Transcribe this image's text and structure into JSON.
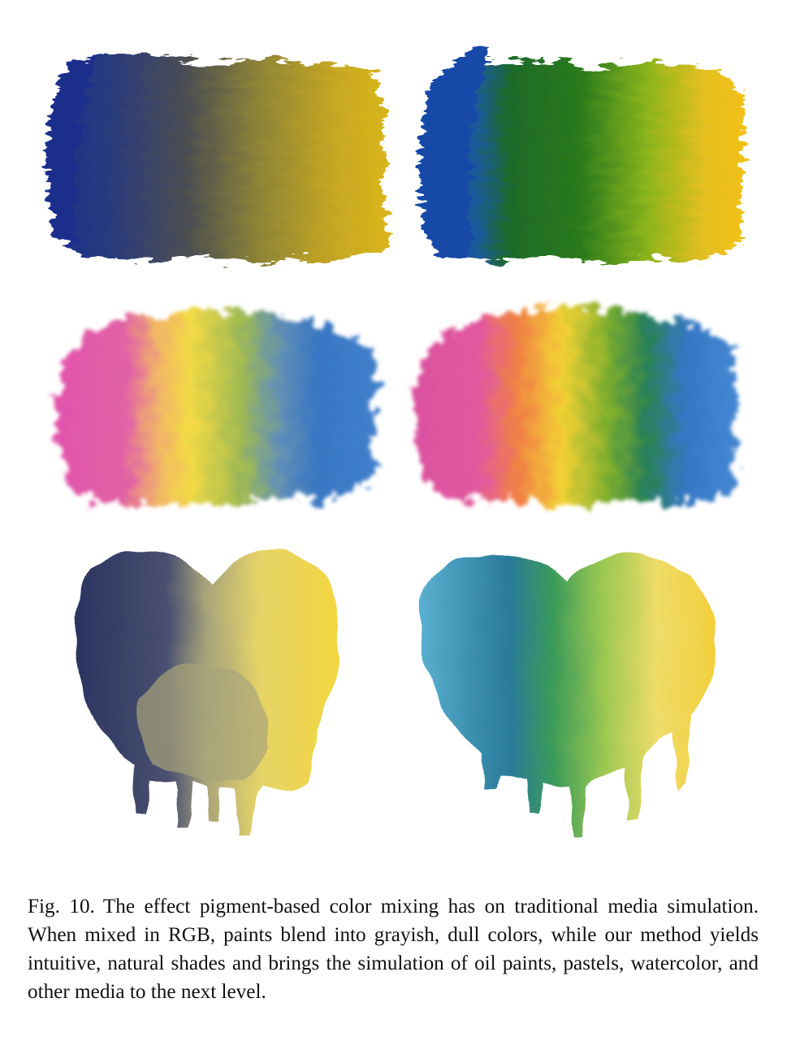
{
  "figure": {
    "panels": [
      {
        "name": "oil-rgb",
        "medium": "oil paint",
        "mixing": "RGB",
        "colors": [
          "#1c2f8c",
          "#5b5a3e",
          "#d4b21a"
        ]
      },
      {
        "name": "oil-pigment",
        "medium": "oil paint",
        "mixing": "pigment",
        "colors": [
          "#1748a8",
          "#1f6e1e",
          "#6fa81e",
          "#f0c21a"
        ]
      },
      {
        "name": "pastel-rgb",
        "medium": "pastel",
        "mixing": "RGB",
        "colors": [
          "#e04aa8",
          "#f0b060",
          "#f2d83a",
          "#8fb04a",
          "#2e6fc0"
        ]
      },
      {
        "name": "pastel-pigment",
        "medium": "pastel",
        "mixing": "pigment",
        "colors": [
          "#d8489a",
          "#f07a3a",
          "#f2cf2a",
          "#78aa22",
          "#1e7a4a",
          "#2a6fc0"
        ]
      },
      {
        "name": "watercolor-rgb",
        "medium": "watercolor",
        "mixing": "RGB",
        "colors": [
          "#2a3460",
          "#a8a47a",
          "#f3d640"
        ]
      },
      {
        "name": "watercolor-pigment",
        "medium": "watercolor",
        "mixing": "pigment",
        "colors": [
          "#3c94b8",
          "#1a5a7a",
          "#5aa844",
          "#c8d85a",
          "#f2cf3a"
        ]
      }
    ]
  },
  "caption": {
    "label": "Fig. 10.",
    "text": "The effect pigment-based color mixing has on traditional media simulation. When mixed in RGB, paints blend into grayish, dull colors, while our method yields intuitive, natural shades and brings the simulation of oil paints, pastels, watercolor, and other media to the next level."
  }
}
